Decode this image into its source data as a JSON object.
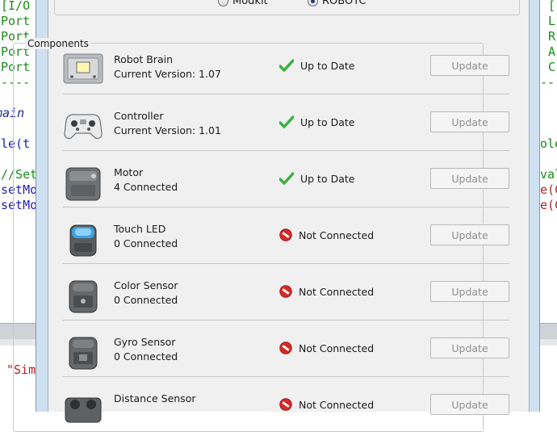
{
  "editor": {
    "left_lines": [
      "[I/O",
      "Port",
      "Port",
      "Port",
      "Port",
      "----",
      "main",
      "ile(t",
      "//Set",
      "setMo",
      "setMo"
    ],
    "right_lines": [
      "[",
      "L",
      "R",
      "A",
      "C",
      "--",
      "ole",
      "val",
      "e(C",
      "e(C"
    ],
    "bottom_text": "\"Sim"
  },
  "dialog": {
    "language_options": [
      {
        "label": "Modkit",
        "selected": false
      },
      {
        "label": "ROBOTC",
        "selected": true
      }
    ],
    "components_label": "Components",
    "components": [
      {
        "name": "Robot Brain",
        "detail": "Current Version: 1.07",
        "status": "Up to Date",
        "status_icon": "check-icon",
        "button": "Update",
        "thumb": "brain"
      },
      {
        "name": "Controller",
        "detail": "Current Version: 1.01",
        "status": "Up to Date",
        "status_icon": "check-icon",
        "button": "Update",
        "thumb": "controller"
      },
      {
        "name": "Motor",
        "detail": "4 Connected",
        "status": "Up to Date",
        "status_icon": "check-icon",
        "button": "Update",
        "thumb": "motor"
      },
      {
        "name": "Touch LED",
        "detail": "0 Connected",
        "status": "Not Connected",
        "status_icon": "no-entry-icon",
        "button": "Update",
        "thumb": "touchled"
      },
      {
        "name": "Color Sensor",
        "detail": "0 Connected",
        "status": "Not Connected",
        "status_icon": "no-entry-icon",
        "button": "Update",
        "thumb": "color"
      },
      {
        "name": "Gyro Sensor",
        "detail": "0 Connected",
        "status": "Not Connected",
        "status_icon": "no-entry-icon",
        "button": "Update",
        "thumb": "gyro"
      },
      {
        "name": "Distance Sensor",
        "detail": "",
        "status": "Not Connected",
        "status_icon": "no-entry-icon",
        "button": "Update",
        "thumb": "distance"
      }
    ]
  },
  "colors": {
    "ok_green": "#3cb043",
    "error_red": "#d42a2a",
    "code_green": "#1a8a1a",
    "code_blue": "#1f1fa8",
    "code_red": "#b22222"
  }
}
